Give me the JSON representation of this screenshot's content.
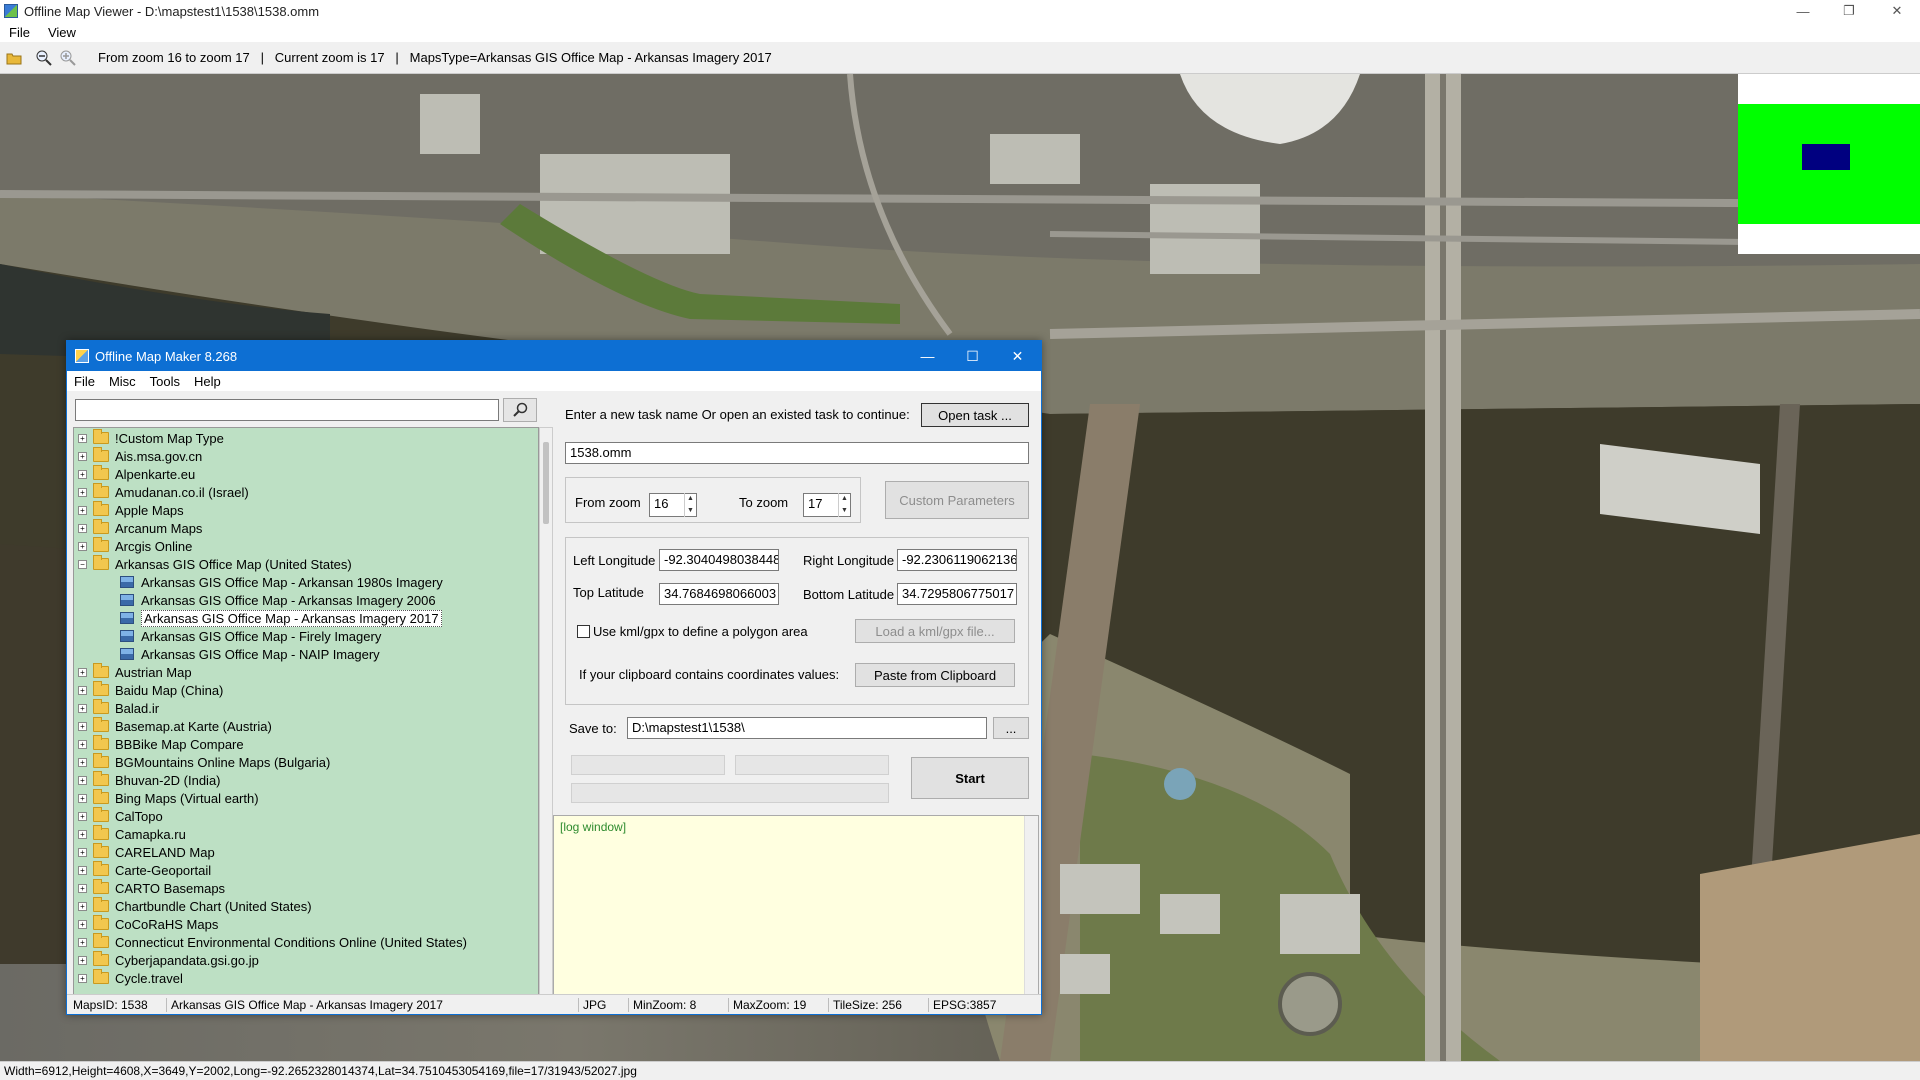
{
  "window": {
    "title": "Offline Map Viewer - D:\\mapstest1\\1538\\1538.omm"
  },
  "menu": [
    "File",
    "View"
  ],
  "toolbar": {
    "info": "From zoom 16 to zoom 17   |   Current zoom is 17   |   MapsType=Arkansas GIS Office Map - Arkansas Imagery 2017"
  },
  "status": "Width=6912,Height=4608,X=3649,Y=2002,Long=-92.2652328014374,Lat=34.7510453054169,file=17/31943/52027.jpg",
  "colors": {
    "accent": "#0d6fd3",
    "tree_bg": "#bde0c4",
    "log_bg": "#ffffe0",
    "overview_green": "#00ff00",
    "overview_blue": "#000080"
  },
  "dialog": {
    "title": "Offline Map Maker 8.268",
    "menu": [
      "File",
      "Misc",
      "Tools",
      "Help"
    ],
    "search_value": "",
    "tree": [
      {
        "label": "!Custom Map Type",
        "level": 0,
        "expanded": false
      },
      {
        "label": "Ais.msa.gov.cn",
        "level": 0,
        "expanded": false
      },
      {
        "label": "Alpenkarte.eu",
        "level": 0,
        "expanded": false
      },
      {
        "label": "Amudanan.co.il (Israel)",
        "level": 0,
        "expanded": false
      },
      {
        "label": "Apple Maps",
        "level": 0,
        "expanded": false
      },
      {
        "label": "Arcanum Maps",
        "level": 0,
        "expanded": false
      },
      {
        "label": "Arcgis Online",
        "level": 0,
        "expanded": false
      },
      {
        "label": "Arkansas GIS Office Map (United States)",
        "level": 0,
        "expanded": true
      },
      {
        "label": "Arkansas GIS Office Map - Arkansan 1980s Imagery",
        "level": 1
      },
      {
        "label": "Arkansas GIS Office Map - Arkansas Imagery 2006",
        "level": 1
      },
      {
        "label": "Arkansas GIS Office Map - Arkansas Imagery 2017",
        "level": 1,
        "selected": true
      },
      {
        "label": "Arkansas GIS Office Map - Firely Imagery",
        "level": 1
      },
      {
        "label": "Arkansas GIS Office Map - NAIP Imagery",
        "level": 1
      },
      {
        "label": "Austrian Map",
        "level": 0,
        "expanded": false
      },
      {
        "label": "Baidu Map (China)",
        "level": 0,
        "expanded": false
      },
      {
        "label": "Balad.ir",
        "level": 0,
        "expanded": false
      },
      {
        "label": "Basemap.at Karte (Austria)",
        "level": 0,
        "expanded": false
      },
      {
        "label": "BBBike Map Compare",
        "level": 0,
        "expanded": false
      },
      {
        "label": "BGMountains Online Maps (Bulgaria)",
        "level": 0,
        "expanded": false
      },
      {
        "label": "Bhuvan-2D (India)",
        "level": 0,
        "expanded": false
      },
      {
        "label": "Bing Maps (Virtual earth)",
        "level": 0,
        "expanded": false
      },
      {
        "label": "CalTopo",
        "level": 0,
        "expanded": false
      },
      {
        "label": "Camapka.ru",
        "level": 0,
        "expanded": false
      },
      {
        "label": "CARELAND Map",
        "level": 0,
        "expanded": false
      },
      {
        "label": "Carte-Geoportail",
        "level": 0,
        "expanded": false
      },
      {
        "label": "CARTO Basemaps",
        "level": 0,
        "expanded": false
      },
      {
        "label": "Chartbundle Chart (United States)",
        "level": 0,
        "expanded": false
      },
      {
        "label": "CoCoRaHS Maps",
        "level": 0,
        "expanded": false
      },
      {
        "label": "Connecticut Environmental Conditions Online (United States)",
        "level": 0,
        "expanded": false
      },
      {
        "label": "Cyberjapandata.gsi.go.jp",
        "level": 0,
        "expanded": false
      },
      {
        "label": "Cycle.travel",
        "level": 0,
        "expanded": false
      }
    ],
    "task_prompt": "Enter a new task name Or open an existed task to continue:",
    "open_task_label": "Open task ...",
    "task_name": "1538.omm",
    "from_zoom_label": "From zoom",
    "from_zoom": "16",
    "to_zoom_label": "To zoom",
    "to_zoom": "17",
    "custom_params_label": "Custom Parameters",
    "left_lon_label": "Left Longitude",
    "left_lon": "-92.3040498038448",
    "right_lon_label": "Right Longitude",
    "right_lon": "-92.2306119062136",
    "top_lat_label": "Top Latitude",
    "top_lat": "34.7684698066003",
    "bottom_lat_label": "Bottom Latitude",
    "bottom_lat": "34.7295806775017",
    "kml_label": "Use kml/gpx to define a polygon area",
    "load_kml_label": "Load a kml/gpx file...",
    "clipboard_prompt": "If your clipboard contains coordinates values:",
    "paste_label": "Paste from Clipboard",
    "save_to_label": "Save to:",
    "save_to": "D:\\mapstest1\\1538\\",
    "browse_label": "...",
    "start_label": "Start",
    "log_text": "[log window]",
    "status": {
      "mapsid": "MapsID: 1538",
      "name": "Arkansas GIS Office Map - Arkansas Imagery 2017",
      "format": "JPG",
      "minzoom": "MinZoom: 8",
      "maxzoom": "MaxZoom: 19",
      "tilesize": "TileSize: 256",
      "epsg": "EPSG:3857"
    }
  }
}
